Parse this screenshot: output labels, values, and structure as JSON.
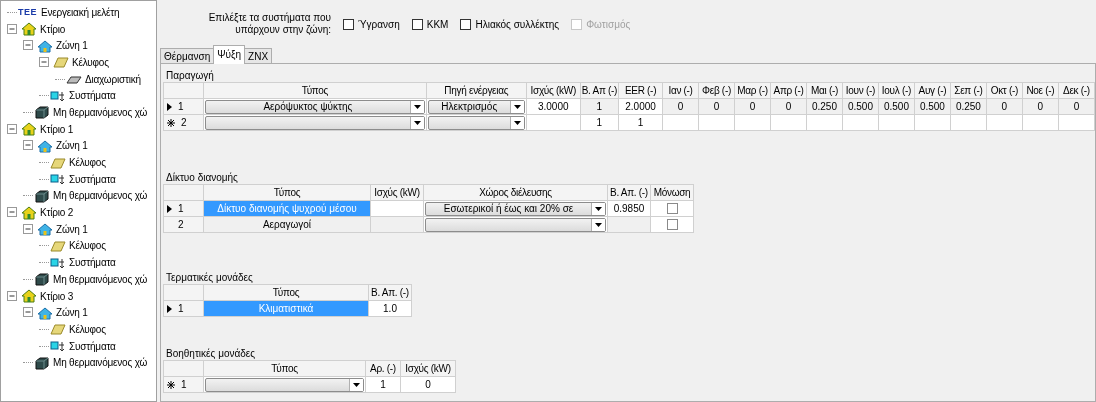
{
  "tree": {
    "logo": "TEE",
    "label": "Ενεργειακή μελέτη",
    "children": [
      {
        "kind": "building",
        "label": "Κτίριο",
        "expanded": true,
        "children": [
          {
            "kind": "zone",
            "label": "Ζώνη 1",
            "expanded": true,
            "children": [
              {
                "kind": "envelope",
                "label": "Κέλυφος",
                "expanded": true,
                "children": [
                  {
                    "kind": "partition",
                    "label": "Διαχωριστική"
                  }
                ]
              },
              {
                "kind": "systems",
                "label": "Συστήματα"
              }
            ]
          },
          {
            "kind": "unheated",
            "label": "Μη θερμαινόμενος χώ"
          }
        ]
      },
      {
        "kind": "building",
        "label": "Κτίριο 1",
        "expanded": true,
        "children": [
          {
            "kind": "zone",
            "label": "Ζώνη 1",
            "expanded": true,
            "children": [
              {
                "kind": "envelope",
                "label": "Κέλυφος"
              },
              {
                "kind": "systems",
                "label": "Συστήματα"
              }
            ]
          },
          {
            "kind": "unheated",
            "label": "Μη θερμαινόμενος χώ"
          }
        ]
      },
      {
        "kind": "building",
        "label": "Κτίριο 2",
        "expanded": true,
        "children": [
          {
            "kind": "zone",
            "label": "Ζώνη 1",
            "expanded": true,
            "children": [
              {
                "kind": "envelope",
                "label": "Κέλυφος"
              },
              {
                "kind": "systems",
                "label": "Συστήματα"
              }
            ]
          },
          {
            "kind": "unheated",
            "label": "Μη θερμαινόμενος χώ"
          }
        ]
      },
      {
        "kind": "building",
        "label": "Κτίριο 3",
        "expanded": true,
        "children": [
          {
            "kind": "zone",
            "label": "Ζώνη 1",
            "expanded": true,
            "children": [
              {
                "kind": "envelope",
                "label": "Κέλυφος"
              },
              {
                "kind": "systems",
                "label": "Συστήματα"
              }
            ]
          },
          {
            "kind": "unheated",
            "label": "Μη θερμαινόμενος χώ"
          }
        ]
      }
    ]
  },
  "prompt": "Επιλέξτε τα συστήματα που υπάρχουν στην ζώνη:",
  "options": [
    {
      "label": "Ύγρανση",
      "checked": false,
      "disabled": false
    },
    {
      "label": "ΚΚΜ",
      "checked": false,
      "disabled": false
    },
    {
      "label": "Ηλιακός συλλέκτης",
      "checked": false,
      "disabled": false
    },
    {
      "label": "Φωτισμός",
      "checked": false,
      "disabled": true
    }
  ],
  "tabs": [
    {
      "label": "Θέρμανση",
      "selected": false
    },
    {
      "label": "Ψύξη",
      "selected": true
    },
    {
      "label": "ZNX",
      "selected": false
    }
  ],
  "sections": [
    {
      "title": "Παραγωγή",
      "columns": [
        "Τύπος",
        "Πηγή ενέργειας",
        "Ισχύς (kW)",
        "Β. Απ (-)",
        "EER (-)",
        "Ιαν (-)",
        "Φεβ (-)",
        "Μαρ (-)",
        "Απρ (-)",
        "Μαι (-)",
        "Ιουν (-)",
        "Ιουλ (-)",
        "Αυγ (-)",
        "Σεπ (-)",
        "Οκτ (-)",
        "Νοε (-)",
        "Δεκ (-)"
      ],
      "rows": [
        {
          "current": true,
          "new_row": false,
          "number": "1",
          "cells": [
            {
              "kind": "combo",
              "value": "Αερόψυκτος ψύκτης"
            },
            {
              "kind": "combo",
              "value": "Ηλεκτρισμός"
            },
            {
              "kind": "text",
              "value": "3.0000"
            },
            {
              "kind": "readonly",
              "value": "1"
            },
            {
              "kind": "text",
              "value": "2.0000"
            },
            {
              "kind": "readonly",
              "value": "0"
            },
            {
              "kind": "readonly",
              "value": "0"
            },
            {
              "kind": "readonly",
              "value": "0"
            },
            {
              "kind": "readonly",
              "value": "0"
            },
            {
              "kind": "readonly",
              "value": "0.250"
            },
            {
              "kind": "readonly",
              "value": "0.500"
            },
            {
              "kind": "readonly",
              "value": "0.500"
            },
            {
              "kind": "readonly",
              "value": "0.500"
            },
            {
              "kind": "readonly",
              "value": "0.250"
            },
            {
              "kind": "readonly",
              "value": "0"
            },
            {
              "kind": "readonly",
              "value": "0"
            },
            {
              "kind": "readonly",
              "value": "0"
            }
          ]
        },
        {
          "current": false,
          "new_row": true,
          "number": "2",
          "cells": [
            {
              "kind": "combo"
            },
            {
              "kind": "combo"
            },
            {
              "kind": "text"
            },
            {
              "kind": "text",
              "value": "1"
            },
            {
              "kind": "text",
              "value": "1"
            },
            {
              "kind": "text"
            },
            {
              "kind": "text"
            },
            {
              "kind": "text"
            },
            {
              "kind": "text"
            },
            {
              "kind": "text"
            },
            {
              "kind": "text"
            },
            {
              "kind": "text"
            },
            {
              "kind": "text"
            },
            {
              "kind": "text"
            },
            {
              "kind": "text"
            },
            {
              "kind": "text"
            },
            {
              "kind": "text"
            }
          ]
        }
      ]
    },
    {
      "title": "Δίκτυο διανομής",
      "columns": [
        "Τύπος",
        "Ισχύς (kW)",
        "Χώρος διέλευσης",
        "Β. Απ. (-)",
        "Μόνωση"
      ],
      "rows": [
        {
          "current": true,
          "new_row": false,
          "number": "1",
          "cells": [
            {
              "kind": "selected",
              "value": "Δίκτυο διανομής ψυχρού μέσου"
            },
            {
              "kind": "text"
            },
            {
              "kind": "combo",
              "value": "Εσωτερικοί  ή έως και 20% σε"
            },
            {
              "kind": "text",
              "value": "0.9850"
            },
            {
              "kind": "check",
              "checked": false
            }
          ]
        },
        {
          "current": false,
          "new_row": false,
          "number": "2",
          "cells": [
            {
              "kind": "readonly",
              "value": "Αεραγωγοί"
            },
            {
              "kind": "readonly"
            },
            {
              "kind": "combo"
            },
            {
              "kind": "readonly"
            },
            {
              "kind": "check",
              "checked": false
            }
          ]
        }
      ]
    },
    {
      "title": "Τερματικές μονάδες",
      "columns": [
        "Τύπος",
        "Β. Απ. (-)"
      ],
      "rows": [
        {
          "current": true,
          "new_row": false,
          "number": "1",
          "cells": [
            {
              "kind": "selected",
              "value": "Κλιματιστικά"
            },
            {
              "kind": "text",
              "value": "1.0"
            }
          ]
        }
      ]
    },
    {
      "title": "Βοηθητικές μονάδες",
      "columns": [
        "Τύπος",
        "Αρ. (-)",
        "Ισχύς (kW)"
      ],
      "rows": [
        {
          "current": false,
          "new_row": true,
          "number": "1",
          "cells": [
            {
              "kind": "combo"
            },
            {
              "kind": "text",
              "value": "1"
            },
            {
              "kind": "text",
              "value": "0"
            }
          ]
        }
      ]
    }
  ]
}
